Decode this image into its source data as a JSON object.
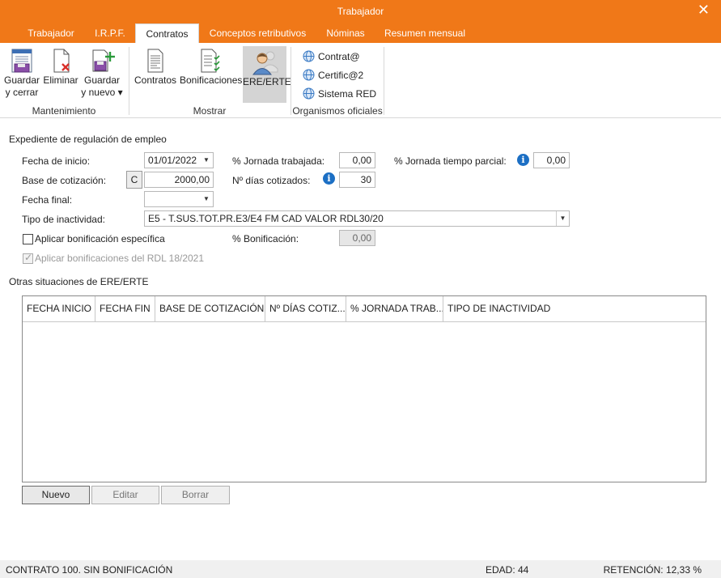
{
  "window": {
    "title": "Trabajador",
    "close_glyph": "✕"
  },
  "tabs": [
    {
      "label": "Trabajador",
      "active": false
    },
    {
      "label": "I.R.P.F.",
      "active": false
    },
    {
      "label": "Contratos",
      "active": true
    },
    {
      "label": "Conceptos retributivos",
      "active": false
    },
    {
      "label": "Nóminas",
      "active": false
    },
    {
      "label": "Resumen mensual",
      "active": false
    }
  ],
  "ribbon": {
    "mantenimiento": {
      "label": "Mantenimiento",
      "guardar_cerrar": {
        "line1": "Guardar",
        "line2": "y cerrar",
        "icon": "save-close-icon"
      },
      "eliminar": {
        "label": "Eliminar",
        "icon": "delete-document-icon"
      },
      "guardar_nuevo": {
        "line1": "Guardar",
        "line2": "y nuevo ▾",
        "icon": "save-new-icon"
      }
    },
    "mostrar": {
      "label": "Mostrar",
      "contratos": {
        "label": "Contratos",
        "icon": "document-icon"
      },
      "bonificaciones": {
        "label": "Bonificaciones",
        "icon": "checklist-icon"
      },
      "ere_erte": {
        "label": "ERE/ERTE",
        "icon": "person-icon"
      }
    },
    "organismos": {
      "label": "Organismos oficiales",
      "items": [
        "Contrat@",
        "Certific@2",
        "Sistema RED"
      ],
      "icon": "globe-icon"
    }
  },
  "form": {
    "section_title": "Expediente de regulación de empleo",
    "fecha_inicio": {
      "label": "Fecha de inicio:",
      "value": "01/01/2022"
    },
    "base_cotizacion": {
      "label": "Base de cotización:",
      "button": "C",
      "value": "2000,00"
    },
    "fecha_final": {
      "label": "Fecha final:",
      "value": ""
    },
    "tipo_inactividad": {
      "label": "Tipo de inactividad:",
      "value": "E5 - T.SUS.TOT.PR.E3/E4 FM CAD VALOR RDL30/20"
    },
    "jornada_trabajada": {
      "label": "% Jornada trabajada:",
      "value": "0,00"
    },
    "dias_cotizados": {
      "label": "Nº días cotizados:",
      "value": "30"
    },
    "jornada_parcial": {
      "label": "% Jornada tiempo parcial:",
      "value": "0,00"
    },
    "aplicar_bonificacion": {
      "label": "Aplicar bonificación específica",
      "checked": false
    },
    "bonificacion": {
      "label": "% Bonificación:",
      "value": "0,00"
    },
    "aplicar_rdl": {
      "label": "Aplicar bonificaciones del RDL 18/2021",
      "checked": true,
      "disabled": true
    }
  },
  "otras": {
    "title": "Otras situaciones de ERE/ERTE",
    "columns": [
      "FECHA INICIO",
      "FECHA FIN",
      "BASE DE COTIZACIÓN",
      "Nº DÍAS COTIZ...",
      "% JORNADA TRAB...",
      "TIPO DE INACTIVIDAD"
    ],
    "rows": [],
    "buttons": {
      "nuevo": "Nuevo",
      "editar": "Editar",
      "borrar": "Borrar"
    }
  },
  "status": {
    "contrato": "CONTRATO 100.  SIN BONIFICACIÓN",
    "edad": "EDAD: 44",
    "retencion": "RETENCIÓN: 12,33 %"
  },
  "colors": {
    "accent": "#F07818",
    "info": "#1C6FC4"
  }
}
